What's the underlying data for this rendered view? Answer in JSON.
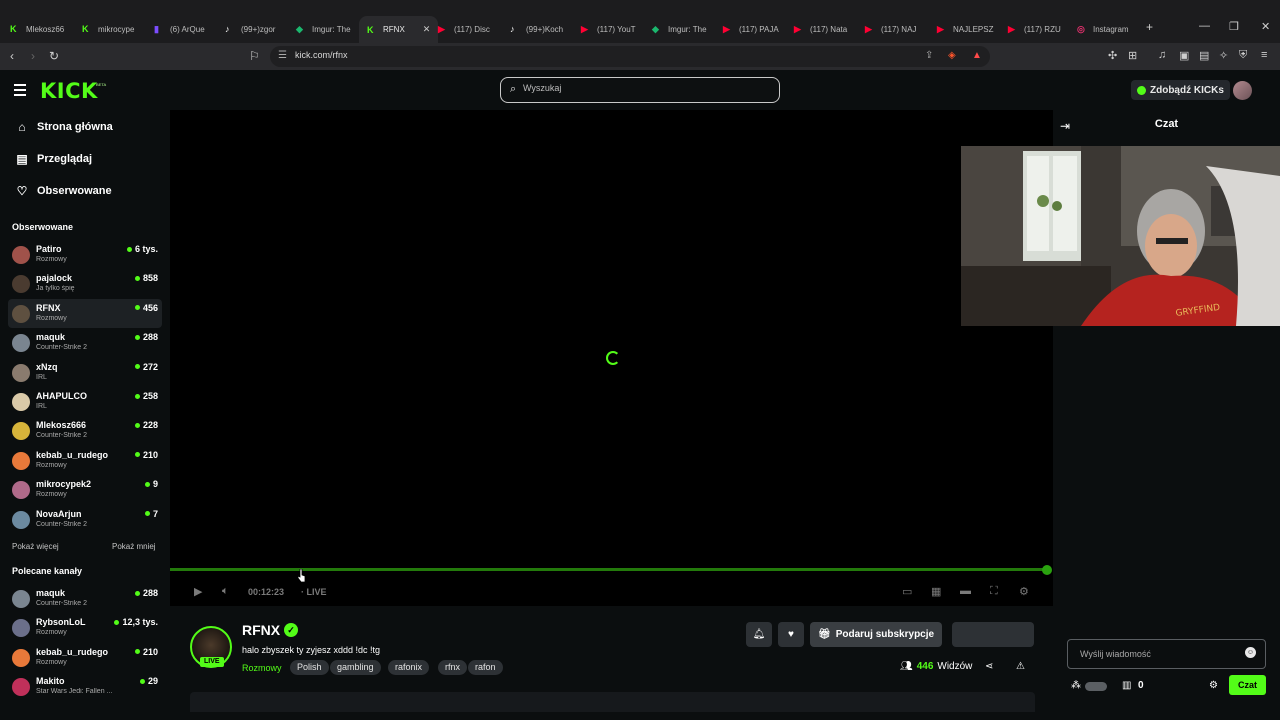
{
  "browser": {
    "tabs": [
      {
        "label": "Mlekosz66",
        "color": "#53fc18",
        "glyph": "K"
      },
      {
        "label": "mikrocype",
        "color": "#53fc18",
        "glyph": "K"
      },
      {
        "label": "(6) ArQue",
        "color": "#7c4dff",
        "glyph": "▮"
      },
      {
        "label": "(99+)zgor",
        "color": "#ffffff",
        "glyph": "♪"
      },
      {
        "label": "Imgur: The",
        "color": "#1bb76e",
        "glyph": "◆"
      },
      {
        "label": "RFNX",
        "color": "#53fc18",
        "glyph": "K",
        "active": true
      },
      {
        "label": "(117) Disc",
        "color": "#ff0033",
        "glyph": "▶"
      },
      {
        "label": "(99+)Koch",
        "color": "#ffffff",
        "glyph": "♪"
      },
      {
        "label": "(117) YouT",
        "color": "#ff0033",
        "glyph": "▶"
      },
      {
        "label": "Imgur: The",
        "color": "#1bb76e",
        "glyph": "◆"
      },
      {
        "label": "(117) PAJA",
        "color": "#ff0033",
        "glyph": "▶"
      },
      {
        "label": "(117) Nata",
        "color": "#ff0033",
        "glyph": "▶"
      },
      {
        "label": "(117) NAJ",
        "color": "#ff0033",
        "glyph": "▶"
      },
      {
        "label": "NAJLEPSZ",
        "color": "#ff0033",
        "glyph": "▶"
      },
      {
        "label": "(117) RZU",
        "color": "#ff0033",
        "glyph": "▶"
      },
      {
        "label": "Instagram",
        "color": "#e1306c",
        "glyph": "◎"
      }
    ],
    "url": "kick.com/rfnx"
  },
  "header": {
    "logo": "KICK",
    "logo_badge": "BETA",
    "search_placeholder": "Wyszukaj",
    "kicks_button": "Zdobądź KICKs"
  },
  "nav": {
    "home": "Strona główna",
    "browse": "Przeglądaj",
    "following": "Obserwowane"
  },
  "following_section": {
    "title": "Obserwowane",
    "channels": [
      {
        "name": "Patiro",
        "category": "Rozmowy",
        "viewers": "6 tys.",
        "avatar": "#a0524a"
      },
      {
        "name": "pajalock",
        "category": "Ja tylko śpię",
        "viewers": "858",
        "avatar": "#4a3b30"
      },
      {
        "name": "RFNX",
        "category": "Rozmowy",
        "viewers": "456",
        "avatar": "#5e5040",
        "active": true
      },
      {
        "name": "maquk",
        "category": "Counter-Strike 2",
        "viewers": "288",
        "avatar": "#7a8590"
      },
      {
        "name": "xNzq",
        "category": "IRL",
        "viewers": "272",
        "avatar": "#8a7b6e"
      },
      {
        "name": "AHAPULCO",
        "category": "IRL",
        "viewers": "258",
        "avatar": "#d9c9a8"
      },
      {
        "name": "Mlekosz666",
        "category": "Counter-Strike 2",
        "viewers": "228",
        "avatar": "#d7b43a"
      },
      {
        "name": "kebab_u_rudego",
        "category": "Rozmowy",
        "viewers": "210",
        "avatar": "#e8793a"
      },
      {
        "name": "mikrocypek2",
        "category": "Rozmowy",
        "viewers": "9",
        "avatar": "#b06a8a"
      },
      {
        "name": "NovaArjun",
        "category": "Counter-Strike 2",
        "viewers": "7",
        "avatar": "#6c8aa0"
      }
    ],
    "show_more": "Pokaż więcej",
    "show_less": "Pokaż mniej"
  },
  "recommended_section": {
    "title": "Polecane kanały",
    "channels": [
      {
        "name": "maquk",
        "category": "Counter-Strike 2",
        "viewers": "288",
        "avatar": "#7a8590"
      },
      {
        "name": "RybsonLoL",
        "category": "Rozmowy",
        "viewers": "12,3 tys.",
        "avatar": "#6b6f8a"
      },
      {
        "name": "kebab_u_rudego",
        "category": "Rozmowy",
        "viewers": "210",
        "avatar": "#e8793a"
      },
      {
        "name": "Makito",
        "category": "Star Wars Jedi: Fallen ...",
        "viewers": "29",
        "avatar": "#c0305a"
      }
    ]
  },
  "player": {
    "time": "00:12:23",
    "live_label": "LIVE",
    "progress_fraction": 1.0
  },
  "stream": {
    "name": "RFNX",
    "title": "halo zbyszek ty zyjesz xddd !dc !tg",
    "category": "Rozmowy",
    "tags": [
      "Polish",
      "gambling",
      "rafonix",
      "rfnx",
      "rafon"
    ],
    "live_badge": "LIVE",
    "subscribe_label": "Podaruj subskrypcje",
    "viewers_count": "446",
    "viewers_label": "Widzów"
  },
  "chat": {
    "title": "Czat",
    "input_placeholder": "Wyślij wiadomość",
    "kicks_count": "0",
    "send_label": "Czat"
  }
}
